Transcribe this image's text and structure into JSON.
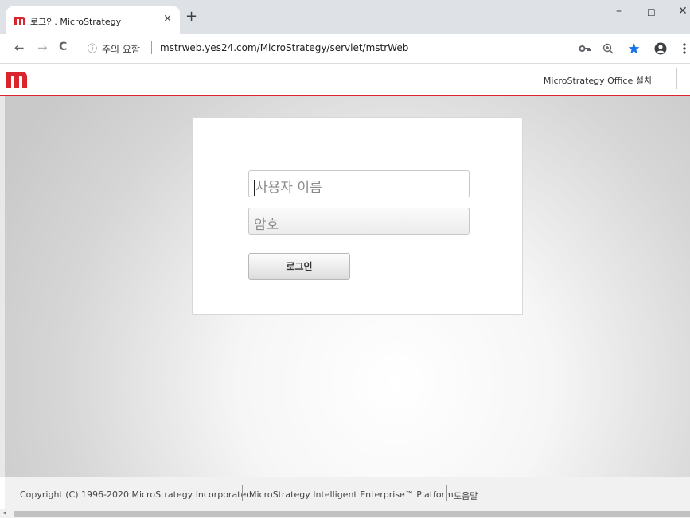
{
  "browser": {
    "tab_title": "로그인. MicroStrategy",
    "tab_close": "×",
    "new_tab": "+",
    "window": {
      "minimize": "–",
      "maximize": "☐",
      "close": "✕"
    },
    "nav": {
      "back": "←",
      "forward": "→",
      "reload": "C"
    },
    "security_icon": "ⓘ",
    "security_text": "주의 요함",
    "url": "mstrweb.yes24.com/MicroStrategy/servlet/mstrWeb",
    "toolbar_icons": {
      "key": "key-icon",
      "zoom": "zoom-icon",
      "bookmark": "star-icon",
      "profile": "account-icon",
      "menu": "menu-icon"
    }
  },
  "app": {
    "brand_color": "#d9262c",
    "office_link": "MicroStrategy Office 설치"
  },
  "login": {
    "username_placeholder": "사용자 이름",
    "password_placeholder": "암호",
    "login_button": "로그인"
  },
  "footer": {
    "copyright": "Copyright (C) 1996-2020 MicroStrategy Incorporated.",
    "platform": "MicroStrategy Intelligent Enterprise™ Platform",
    "help": "도움말"
  }
}
